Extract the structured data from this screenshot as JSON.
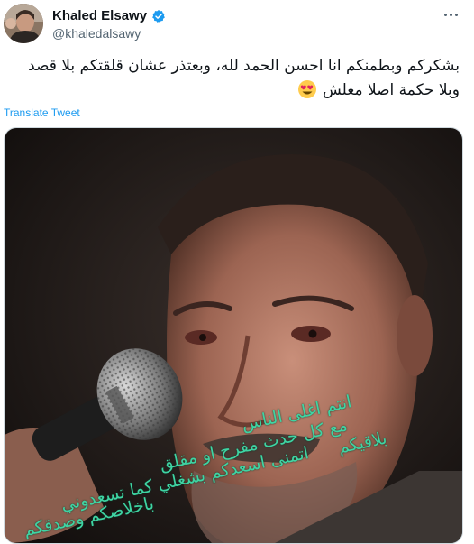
{
  "tweet": {
    "display_name": "Khaled Elsawy",
    "handle": "@khaledalsawy",
    "text": "بشكركم وبطمنكم انا احسن الحمد لله، وبعتذر عشان قلقتكم بلا قصد وبلا حكمة اصلا معلش",
    "emoji": "heart-eyes",
    "translate_label": "Translate Tweet",
    "verified": true
  },
  "image_overlay": {
    "lines": [
      "انتم اغلى الناس",
      "مع كل حدث مفرح او مقلق",
      "اتمنى اسعدكم بشغلي كما تسعدوني",
      "بلاقيكم",
      "باخلاصكم وصدقكم"
    ],
    "color": "#3fd4a3"
  },
  "icons": {
    "verified": "verified-badge-icon",
    "more": "more-options-icon"
  },
  "colors": {
    "link": "#1d9bf0",
    "verified": "#1d9bf0",
    "secondary_text": "#536471"
  }
}
